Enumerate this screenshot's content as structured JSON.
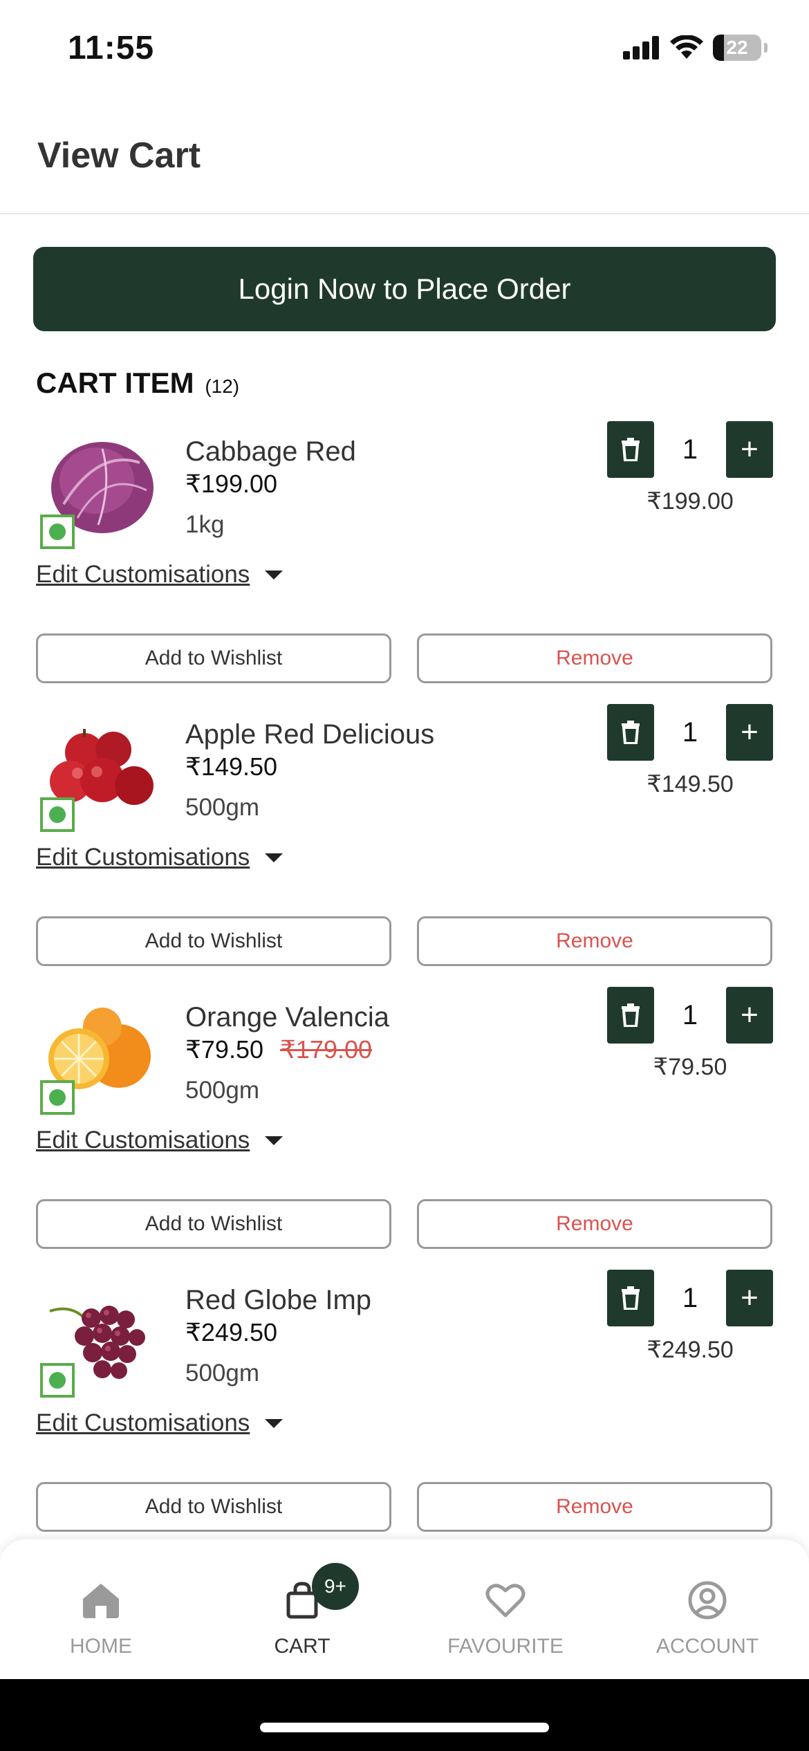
{
  "status_bar": {
    "time": "11:55",
    "battery": "22"
  },
  "header": {
    "title": "View Cart"
  },
  "login_button": "Login Now to Place Order",
  "cart": {
    "title": "CART ITEM",
    "count": "(12)",
    "items": [
      {
        "name": "Cabbage Red",
        "price": "₹199.00",
        "original_price": "",
        "weight": "1kg",
        "qty": "1",
        "line_total": "₹199.00",
        "image": "red-cabbage"
      },
      {
        "name": "Apple Red Delicious",
        "price": "₹149.50",
        "original_price": "",
        "weight": "500gm",
        "qty": "1",
        "line_total": "₹149.50",
        "image": "red-apples"
      },
      {
        "name": "Orange Valencia",
        "price": "₹79.50",
        "original_price": "₹179.00",
        "weight": "500gm",
        "qty": "1",
        "line_total": "₹79.50",
        "image": "oranges"
      },
      {
        "name": "Red Globe Imp",
        "price": "₹249.50",
        "original_price": "",
        "weight": "500gm",
        "qty": "1",
        "line_total": "₹249.50",
        "image": "red-grapes"
      }
    ],
    "edit_label": "Edit Customisations",
    "wishlist_label": "Add to Wishlist",
    "remove_label": "Remove"
  },
  "bottom_nav": {
    "items": [
      {
        "label": "HOME",
        "icon": "home-icon"
      },
      {
        "label": "CART",
        "icon": "cart-icon",
        "badge": "9+"
      },
      {
        "label": "FAVOURITE",
        "icon": "heart-icon"
      },
      {
        "label": "ACCOUNT",
        "icon": "account-icon"
      }
    ]
  },
  "colors": {
    "primary": "#1f3a2c",
    "danger": "#d9534f",
    "veg": "#4caf50"
  }
}
